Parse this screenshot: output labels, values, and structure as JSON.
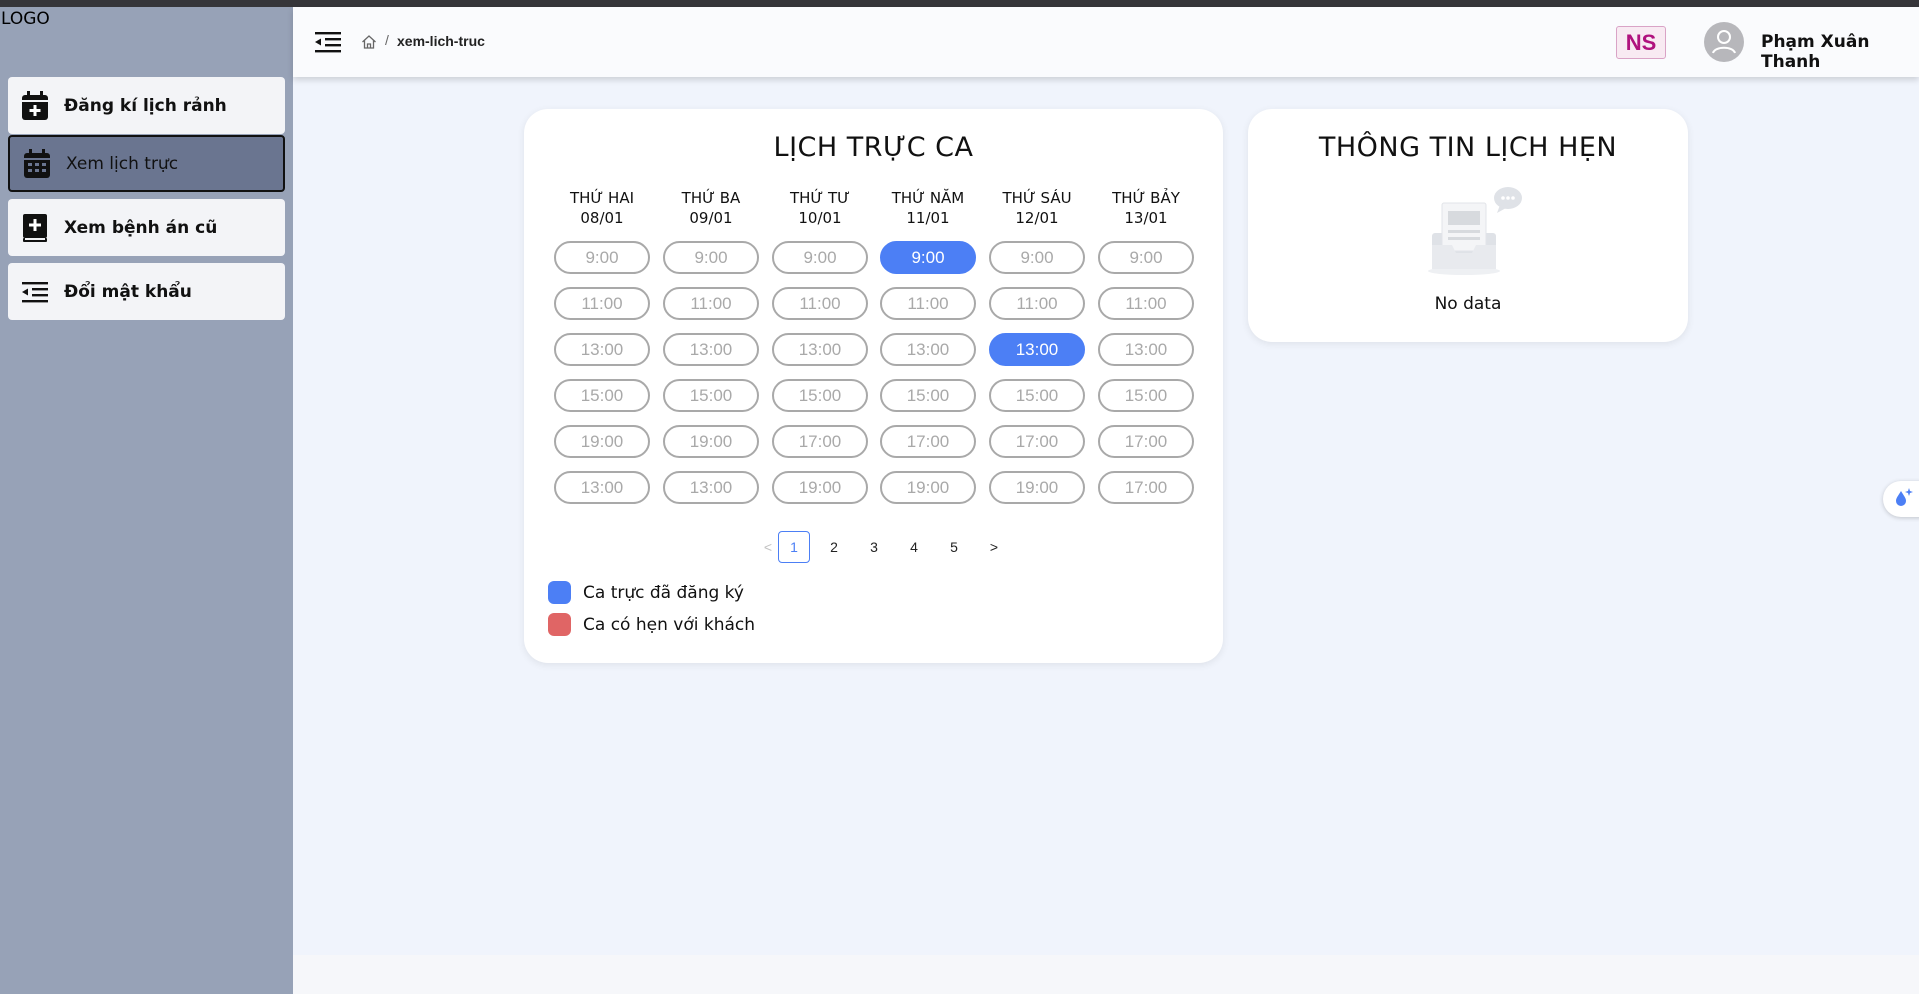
{
  "app": {
    "logo": "LOGO"
  },
  "sidebar": {
    "items": [
      {
        "label": "Đăng kí lịch rảnh",
        "icon": "calendar-plus-icon"
      },
      {
        "label": "Xem lịch trực",
        "icon": "calendar-grid-icon",
        "active": true
      },
      {
        "label": "Xem bệnh án cũ",
        "icon": "medical-book-icon"
      },
      {
        "label": "Đổi mật khẩu",
        "icon": "indent-list-icon"
      }
    ]
  },
  "header": {
    "breadcrumb_separator": "/",
    "breadcrumb_current": "xem-lich-truc",
    "badge": "NS",
    "user_name": "Phạm Xuân Thanh"
  },
  "schedule": {
    "title": "LỊCH TRỰC CA",
    "days": [
      {
        "name": "THỨ HAI",
        "date": "08/01",
        "slots": [
          "9:00",
          "11:00",
          "13:00",
          "15:00",
          "19:00",
          "13:00"
        ],
        "registered": []
      },
      {
        "name": "THỨ BA",
        "date": "09/01",
        "slots": [
          "9:00",
          "11:00",
          "13:00",
          "15:00",
          "19:00",
          "13:00"
        ],
        "registered": []
      },
      {
        "name": "THỨ TƯ",
        "date": "10/01",
        "slots": [
          "9:00",
          "11:00",
          "13:00",
          "15:00",
          "17:00",
          "19:00"
        ],
        "registered": []
      },
      {
        "name": "THỨ NĂM",
        "date": "11/01",
        "slots": [
          "9:00",
          "11:00",
          "13:00",
          "15:00",
          "17:00",
          "19:00"
        ],
        "registered": [
          0
        ]
      },
      {
        "name": "THỨ SÁU",
        "date": "12/01",
        "slots": [
          "9:00",
          "11:00",
          "13:00",
          "15:00",
          "17:00",
          "19:00"
        ],
        "registered": [
          2
        ]
      },
      {
        "name": "THỨ BẢY",
        "date": "13/01",
        "slots": [
          "9:00",
          "11:00",
          "13:00",
          "15:00",
          "17:00",
          "17:00"
        ],
        "registered": []
      }
    ],
    "pagination": {
      "prev": "<",
      "pages": [
        "1",
        "2",
        "3",
        "4",
        "5"
      ],
      "current": "1",
      "next": ">"
    },
    "legend": [
      {
        "label": "Ca trực đã đăng ký",
        "color": "#4c7ff5"
      },
      {
        "label": "Ca có hẹn với khách",
        "color": "#e06565"
      }
    ]
  },
  "appointment_info": {
    "title": "THÔNG TIN LỊCH HẸN",
    "empty_text": "No data"
  },
  "colors": {
    "registered": "#4c7ff5",
    "appointment": "#e06565",
    "sidebar_bg": "#97a2b7",
    "sidebar_active": "#6a7590",
    "badge": "#b0127e"
  }
}
